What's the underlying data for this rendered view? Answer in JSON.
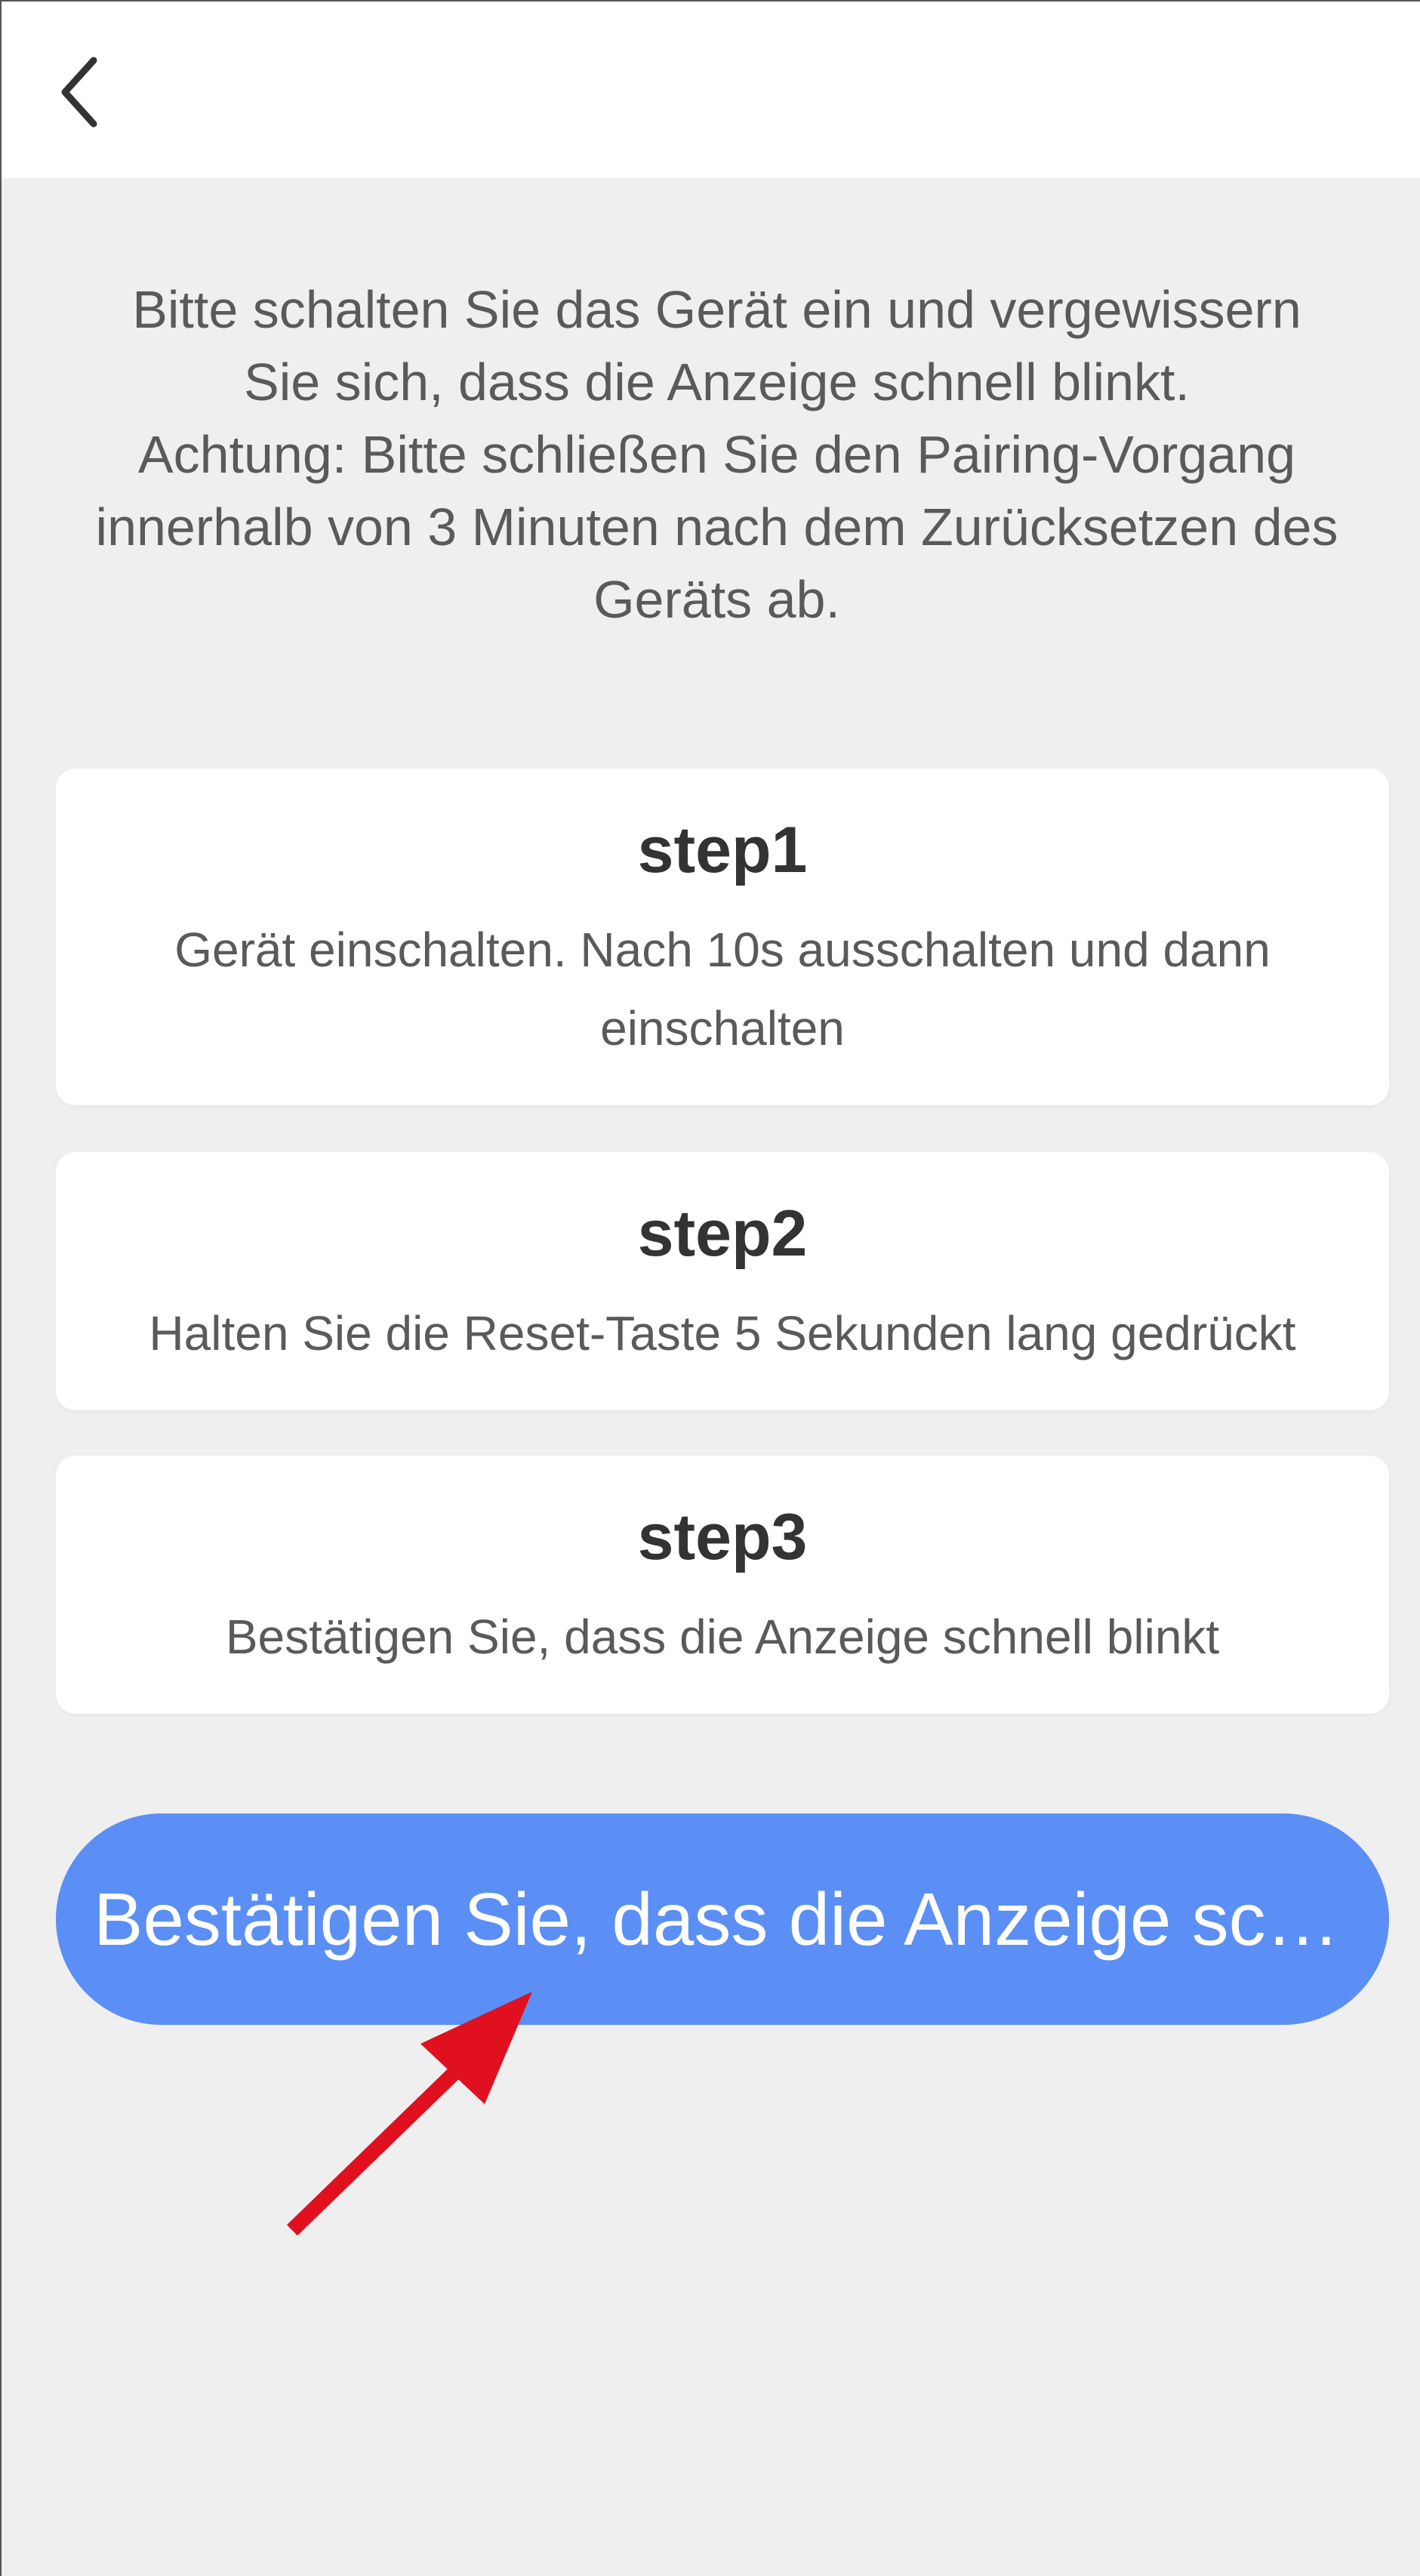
{
  "header": {
    "back_icon": "chevron-left-icon"
  },
  "intro": {
    "line1": "Bitte schalten Sie das Gerät ein und vergewissern Sie sich, dass die Anzeige schnell blinkt.",
    "line2": "Achtung: Bitte schließen Sie den Pairing-Vorgang innerhalb von 3 Minuten nach dem Zurücksetzen des Geräts ab."
  },
  "steps": [
    {
      "title": "step1",
      "description": "Gerät einschalten. Nach 10s ausschalten und dann einschalten"
    },
    {
      "title": "step2",
      "description": "Halten Sie die Reset-Taste 5 Sekunden lang gedrückt"
    },
    {
      "title": "step3",
      "description": "Bestätigen Sie, dass die Anzeige schnell blinkt"
    }
  ],
  "confirm_button": {
    "label": "Bestätigen Sie, dass die Anzeige schnell blinkt"
  },
  "colors": {
    "background": "#efefef",
    "card": "#ffffff",
    "button": "#5b8ff5",
    "arrow": "#e0101f"
  }
}
